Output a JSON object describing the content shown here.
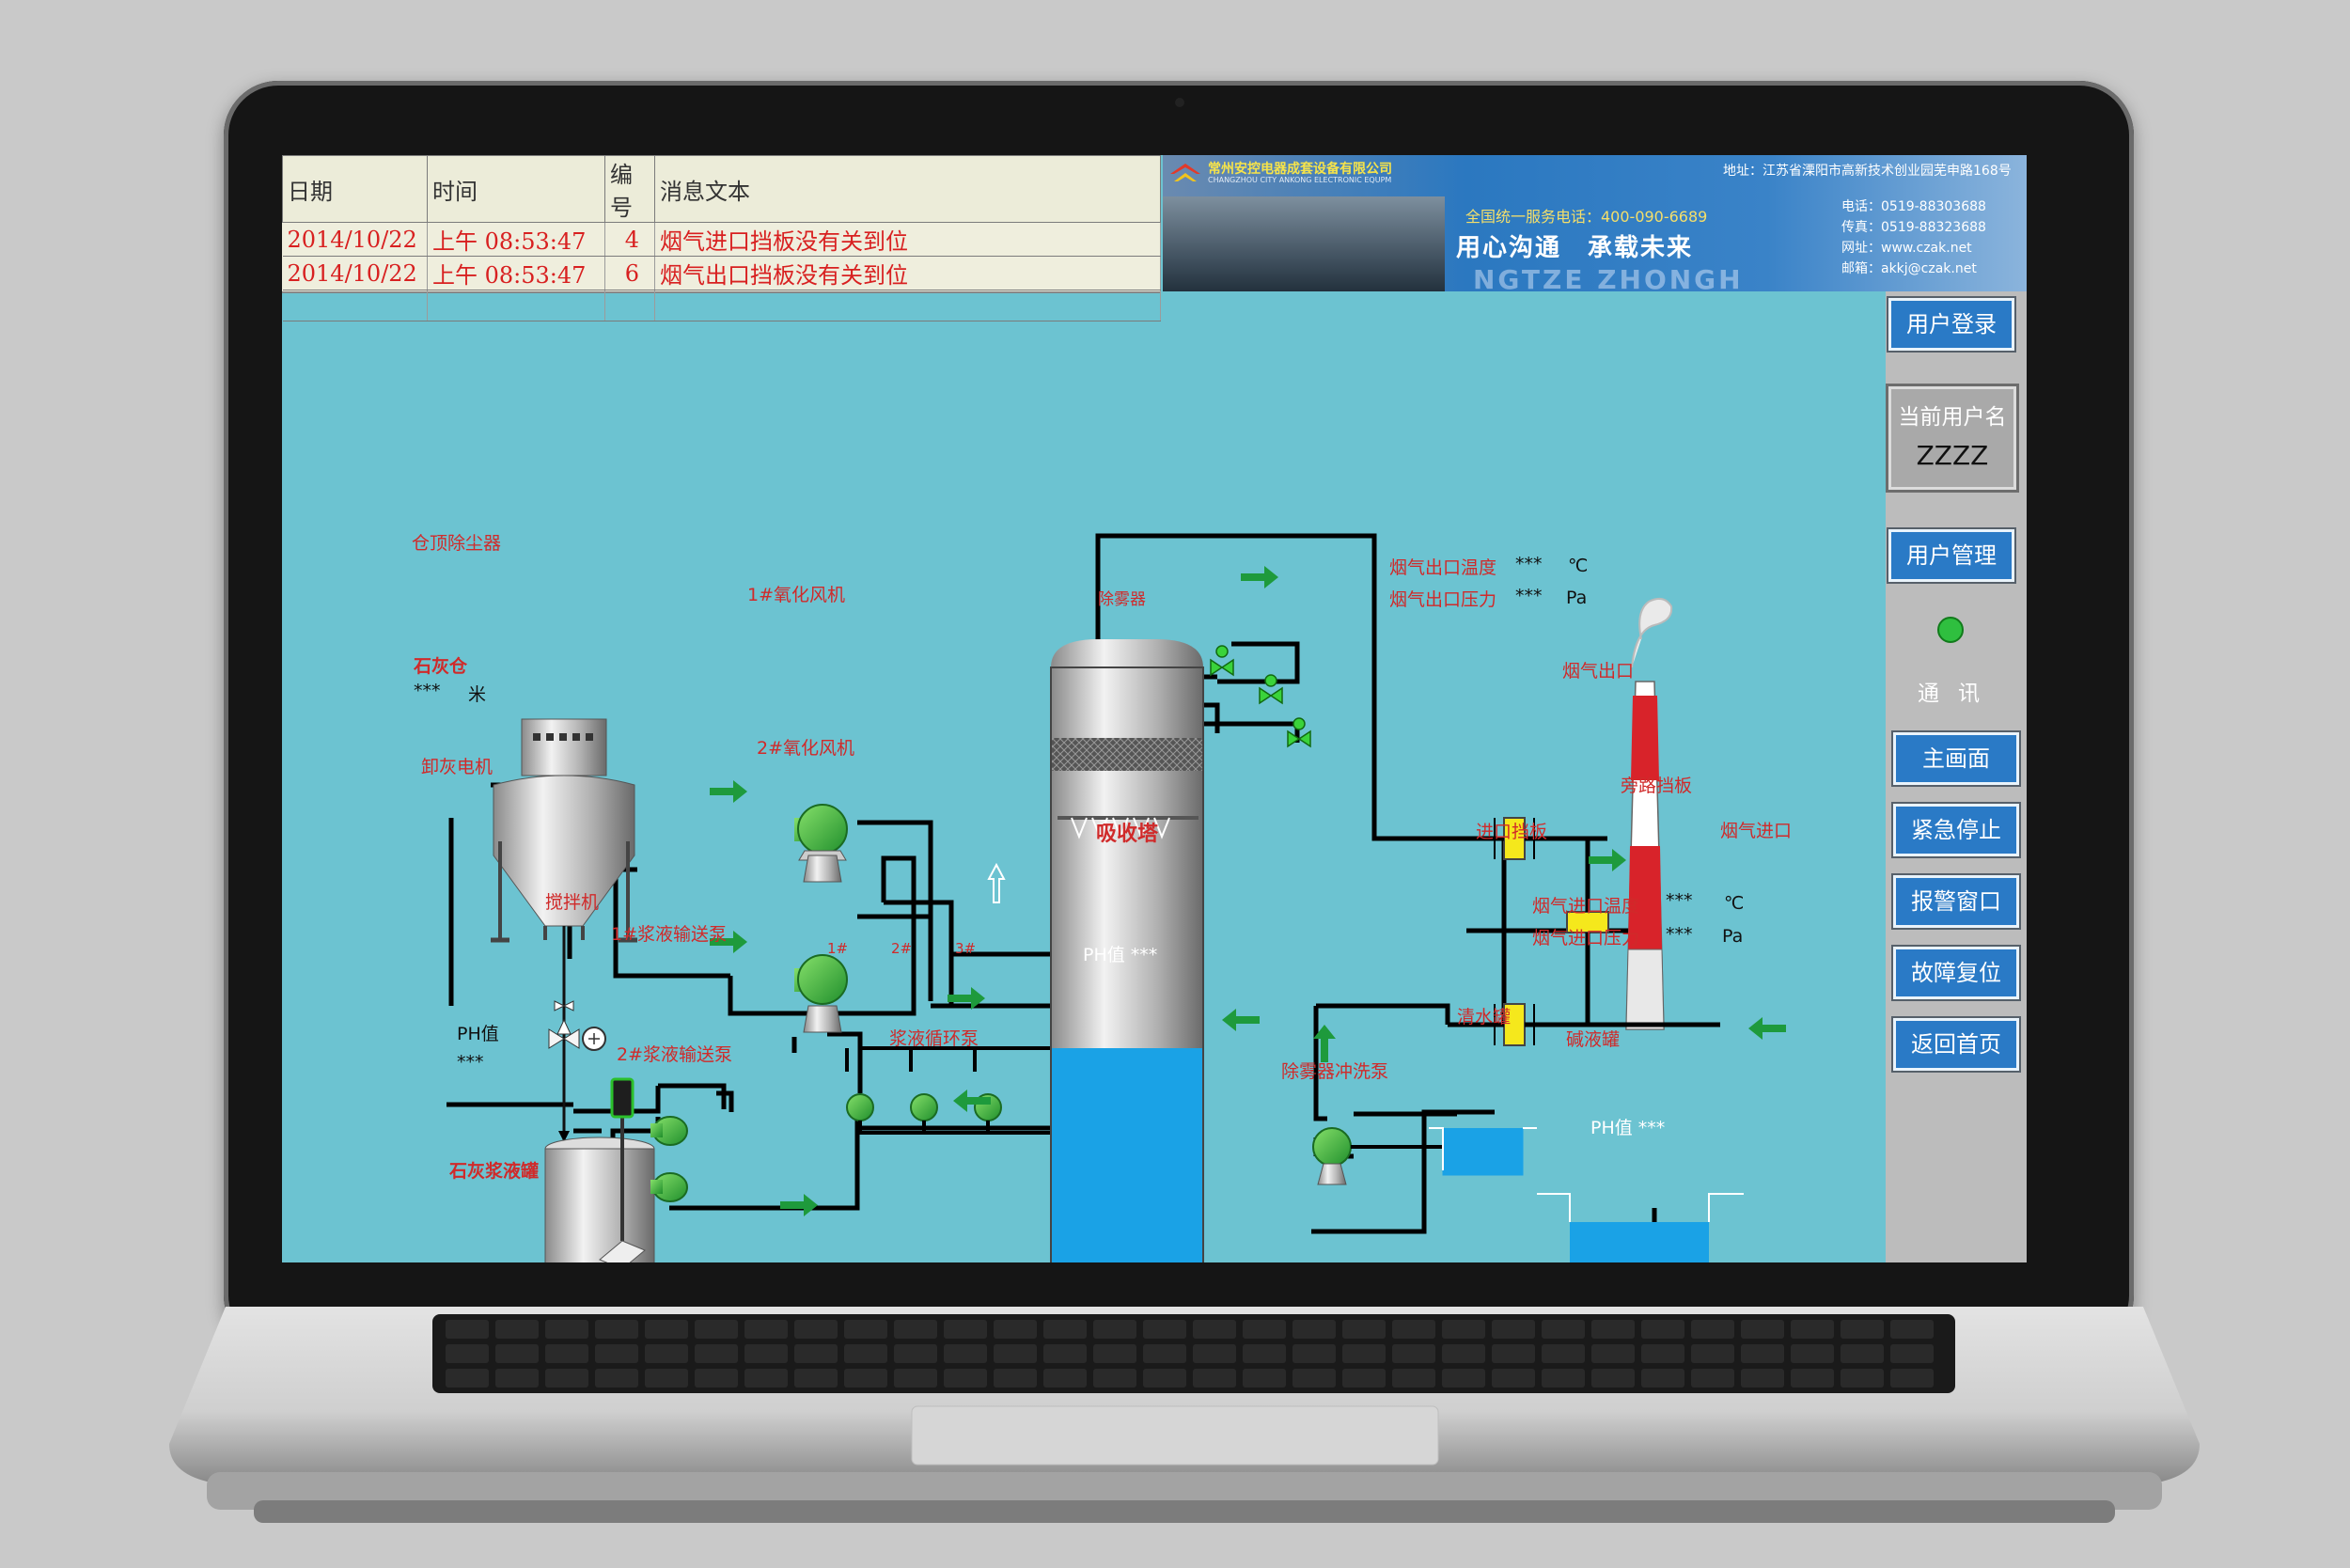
{
  "alarm_table": {
    "headers": [
      "日期",
      "时间",
      "编号",
      "消息文本"
    ],
    "rows": [
      {
        "date": "2014/10/22",
        "time": "上午 08:53:47",
        "id": "4",
        "text": "烟气进口挡板没有关到位"
      },
      {
        "date": "2014/10/22",
        "time": "上午 08:53:47",
        "id": "6",
        "text": "烟气出口挡板没有关到位"
      }
    ]
  },
  "banner": {
    "company": "常州安控电器成套设备有限公司",
    "company_en": "CHANGZHOU CITY ANKONG ELECTRONIC EQUPM",
    "address": "地址：江苏省溧阳市高新技术创业园芜申路168号",
    "hotline": "全国统一服务电话：400-090-6689",
    "slogan": "用心沟通　承载未来",
    "phone": "电话：0519-88303688",
    "fax": "传真：0519-88323688",
    "web": "网址：www.czak.net",
    "email": "邮箱：akkj@czak.net",
    "watermark": "NGTZE ZHONGH"
  },
  "side_panel": {
    "login": "用户登录",
    "current_user_label": "当前用户名",
    "current_user": "ZZZZ",
    "user_manage": "用户管理",
    "comm": "通讯",
    "main_screen": "主画面",
    "emergency_stop": "紧急停止",
    "alarm_window": "报警窗口",
    "fault_reset": "故障复位",
    "back_home": "返回首页"
  },
  "process": {
    "silo_dust": "仓顶除尘器",
    "silo": "石灰仓",
    "silo_value": "***",
    "silo_unit": "米",
    "unload": "卸灰电机",
    "mixer": "搅拌机",
    "slurry_tank": "石灰浆液罐",
    "tank_ph_label": "PH值",
    "tank_ph_value": "***",
    "pump1": "1#浆液输送泵",
    "pump2": "2#浆液输送泵",
    "fan1": "1#氧化风机",
    "fan2": "2#氧化风机",
    "circ_pumps": "浆液循环泵",
    "circ1": "1#",
    "circ2": "2#",
    "circ3": "3#",
    "tower": "吸收塔",
    "demister": "除雾器",
    "tower_ph": "PH值 ***",
    "flush_pump": "除雾器冲洗泵",
    "water_tank": "清水罐",
    "alkali_tank": "碱液罐",
    "alkali_ph": "PH值 ***",
    "out_temp": "烟气出口温度",
    "out_temp_val": "***",
    "out_temp_unit": "℃",
    "out_press": "烟气出口压力",
    "out_press_val": "***",
    "out_press_unit": "Pa",
    "flue_out": "烟气出口",
    "bypass": "旁路挡板",
    "inlet_damper": "进口挡板",
    "flue_in": "烟气进口",
    "in_temp": "烟气进口温度",
    "in_temp_val": "***",
    "in_temp_unit": "℃",
    "in_press": "烟气进口压力",
    "in_press_val": "***",
    "in_press_unit": "Pa"
  },
  "colors": {
    "screen_bg": "#6cc3d1",
    "button_blue": "#2a7ac6",
    "label_red": "#d02a2a",
    "arrow_green": "#1e9a3c",
    "liquid_blue": "#1aa2e6",
    "status_green": "#2fbf3f"
  }
}
